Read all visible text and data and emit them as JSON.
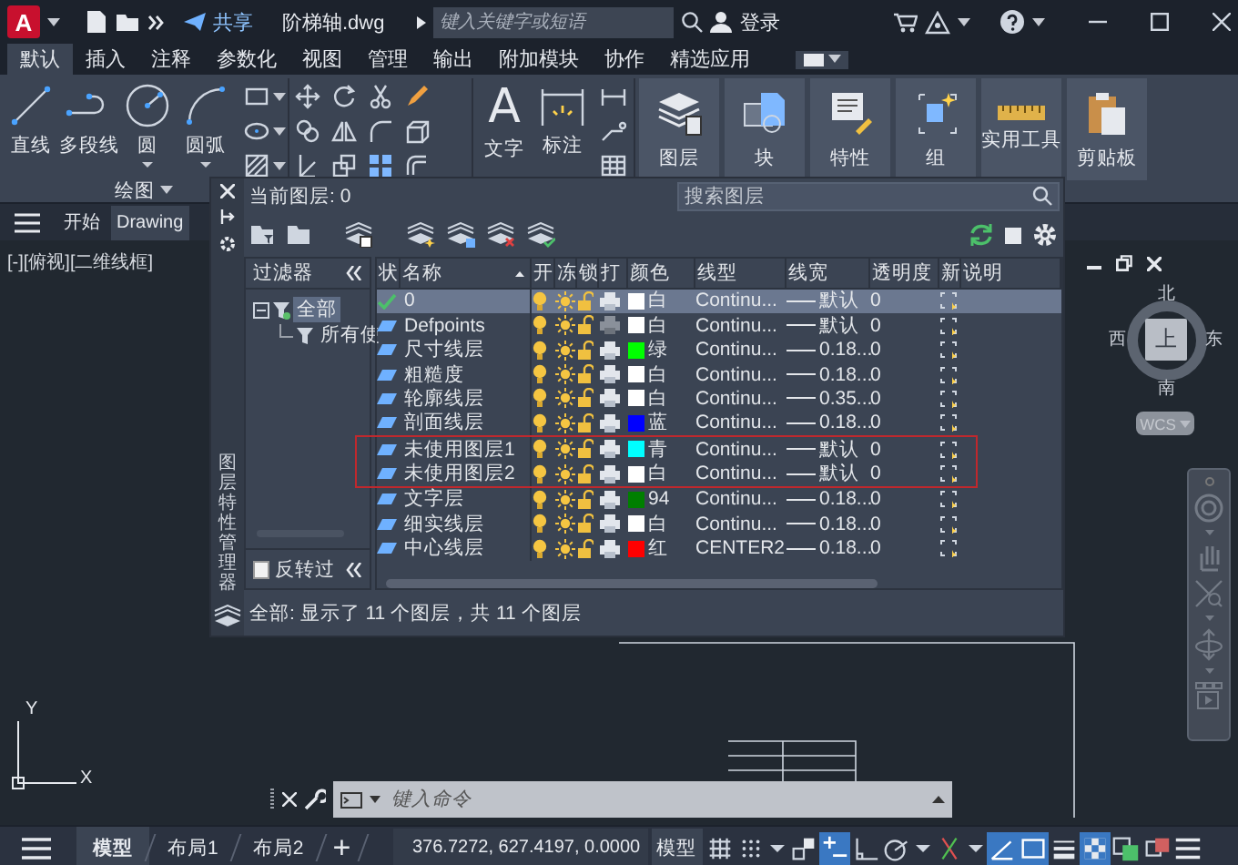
{
  "title_bar": {
    "logo": "A",
    "share": "共享",
    "file_name": "阶梯轴.dwg",
    "search": {
      "placeholder": "键入关键字或短语"
    },
    "sign_in": "登录"
  },
  "ribbon": {
    "tabs": [
      {
        "label": "默认",
        "selected": true
      },
      {
        "label": "插入",
        "selected": false
      },
      {
        "label": "注释",
        "selected": false
      },
      {
        "label": "参数化",
        "selected": false
      },
      {
        "label": "视图",
        "selected": false
      },
      {
        "label": "管理",
        "selected": false
      },
      {
        "label": "输出",
        "selected": false
      },
      {
        "label": "附加模块",
        "selected": false
      },
      {
        "label": "协作",
        "selected": false
      },
      {
        "label": "精选应用",
        "selected": false
      }
    ],
    "draw_tools": [
      {
        "label": "直线",
        "kind": "line",
        "dropdown": false
      },
      {
        "label": "多段线",
        "kind": "polyline",
        "dropdown": false
      },
      {
        "label": "圆",
        "kind": "circle",
        "dropdown": true
      },
      {
        "label": "圆弧",
        "kind": "arc",
        "dropdown": true
      }
    ],
    "text_tool": {
      "glyph": "A",
      "label": "文字"
    },
    "dimension_tool": {
      "label": "标注"
    },
    "big_buttons": [
      {
        "label": "图层",
        "kind": "layers"
      },
      {
        "label": "块",
        "kind": "block"
      },
      {
        "label": "特性",
        "kind": "properties"
      },
      {
        "label": "组",
        "kind": "group"
      },
      {
        "label": "实用工具",
        "kind": "ruler"
      },
      {
        "label": "剪贴板",
        "kind": "clipboard"
      }
    ],
    "panel_label": "绘图"
  },
  "document_tabs": [
    {
      "label": "开始",
      "selected": false
    },
    {
      "label": "Drawing",
      "selected": true
    }
  ],
  "viewport": {
    "view_controls": "[-][俯视][二维线框]",
    "viewcube": {
      "north": "北",
      "south": "南",
      "east": "东",
      "west": "西",
      "face": "上",
      "coordinate_system": "WCS"
    },
    "ucs_axes": {
      "x": "X",
      "y": "Y"
    }
  },
  "command_line": {
    "placeholder": "键入命令"
  },
  "layer_manager": {
    "title": "图层特性管理器",
    "current_layer": "当前图层: 0",
    "search": {
      "placeholder": "搜索图层"
    },
    "filters": {
      "heading": "过滤器",
      "tree": [
        {
          "label": "全部",
          "selected": true,
          "expanded": true,
          "children": [
            {
              "label": "所有使",
              "selected": false
            }
          ]
        }
      ],
      "invert": {
        "label": "反转过",
        "checked": false
      }
    },
    "columns": [
      "状",
      "名称",
      "开",
      "冻",
      "锁",
      "打",
      "颜色",
      "线型",
      "线宽",
      "透明度",
      "新",
      "说明"
    ],
    "rows": [
      {
        "current": true,
        "selected": true,
        "boxed": false,
        "name": "0",
        "on": true,
        "frozen": false,
        "locked": false,
        "plot": true,
        "color": "#ffffff",
        "color_name": "白",
        "linetype": "Continu...",
        "lineweight": "默认",
        "transparency": "0"
      },
      {
        "current": false,
        "selected": false,
        "boxed": false,
        "name": "Defpoints",
        "on": true,
        "frozen": false,
        "locked": false,
        "plot": false,
        "color": "#ffffff",
        "color_name": "白",
        "linetype": "Continu...",
        "lineweight": "默认",
        "transparency": "0"
      },
      {
        "current": false,
        "selected": false,
        "boxed": false,
        "name": "尺寸线层",
        "on": true,
        "frozen": false,
        "locked": false,
        "plot": true,
        "color": "#00ff00",
        "color_name": "绿",
        "linetype": "Continu...",
        "lineweight": "0.18...",
        "transparency": "0"
      },
      {
        "current": false,
        "selected": false,
        "boxed": false,
        "name": "粗糙度",
        "on": true,
        "frozen": false,
        "locked": false,
        "plot": true,
        "color": "#ffffff",
        "color_name": "白",
        "linetype": "Continu...",
        "lineweight": "0.18...",
        "transparency": "0"
      },
      {
        "current": false,
        "selected": false,
        "boxed": false,
        "name": "轮廓线层",
        "on": true,
        "frozen": false,
        "locked": false,
        "plot": true,
        "color": "#ffffff",
        "color_name": "白",
        "linetype": "Continu...",
        "lineweight": "0.35...",
        "transparency": "0"
      },
      {
        "current": false,
        "selected": false,
        "boxed": false,
        "name": "剖面线层",
        "on": true,
        "frozen": false,
        "locked": false,
        "plot": true,
        "color": "#0000ff",
        "color_name": "蓝",
        "linetype": "Continu...",
        "lineweight": "0.18...",
        "transparency": "0"
      },
      {
        "current": false,
        "selected": false,
        "boxed": true,
        "name": "未使用图层1",
        "on": true,
        "frozen": false,
        "locked": false,
        "plot": true,
        "color": "#00ffff",
        "color_name": "青",
        "linetype": "Continu...",
        "lineweight": "默认",
        "transparency": "0"
      },
      {
        "current": false,
        "selected": false,
        "boxed": true,
        "name": "未使用图层2",
        "on": true,
        "frozen": false,
        "locked": false,
        "plot": true,
        "color": "#ffffff",
        "color_name": "白",
        "linetype": "Continu...",
        "lineweight": "默认",
        "transparency": "0"
      },
      {
        "current": false,
        "selected": false,
        "boxed": false,
        "name": "文字层",
        "on": true,
        "frozen": false,
        "locked": false,
        "plot": true,
        "color": "#007f00",
        "color_name": "94",
        "linetype": "Continu...",
        "lineweight": "0.18...",
        "transparency": "0"
      },
      {
        "current": false,
        "selected": false,
        "boxed": false,
        "name": "细实线层",
        "on": true,
        "frozen": false,
        "locked": false,
        "plot": true,
        "color": "#ffffff",
        "color_name": "白",
        "linetype": "Continu...",
        "lineweight": "0.18...",
        "transparency": "0"
      },
      {
        "current": false,
        "selected": false,
        "boxed": false,
        "name": "中心线层",
        "on": true,
        "frozen": false,
        "locked": false,
        "plot": true,
        "color": "#ff0000",
        "color_name": "红",
        "linetype": "CENTER2",
        "lineweight": "0.18...",
        "transparency": "0"
      }
    ],
    "summary": "全部: 显示了 11 个图层，共 11 个图层"
  },
  "status_bar": {
    "layout_tabs": [
      {
        "label": "模型",
        "selected": true
      },
      {
        "label": "布局1",
        "selected": false
      },
      {
        "label": "布局2",
        "selected": false
      }
    ],
    "add_tab": "+",
    "coordinates": "376.7272, 627.4197, 0.0000",
    "space": "模型",
    "toggles": [
      {
        "kind": "grid",
        "on": false
      },
      {
        "kind": "snap",
        "on": false
      },
      {
        "kind": "caret",
        "on": false
      },
      {
        "kind": "ortho_box",
        "on": false
      },
      {
        "kind": "infer",
        "on": true
      },
      {
        "kind": "ortho",
        "on": false
      },
      {
        "kind": "polar",
        "on": false
      },
      {
        "kind": "caret",
        "on": false
      },
      {
        "kind": "osnap",
        "on": false
      },
      {
        "kind": "caret",
        "on": false
      },
      {
        "kind": "angle",
        "on": true
      },
      {
        "kind": "box",
        "on": true
      },
      {
        "kind": "lineweight",
        "on": false
      },
      {
        "kind": "transparency",
        "on": true
      },
      {
        "kind": "cycling",
        "on": false
      },
      {
        "kind": "annotation",
        "on": false
      },
      {
        "kind": "menu",
        "on": false
      }
    ]
  }
}
